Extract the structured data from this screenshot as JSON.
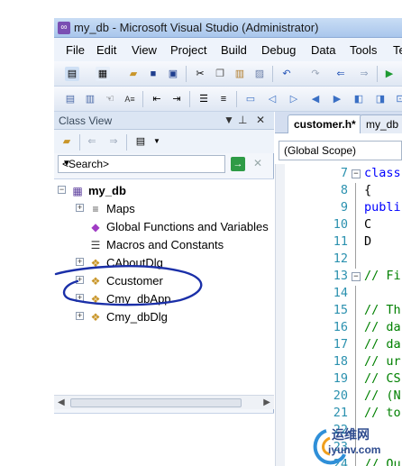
{
  "window": {
    "title": "my_db - Microsoft Visual Studio (Administrator)"
  },
  "menu": [
    "File",
    "Edit",
    "View",
    "Project",
    "Build",
    "Debug",
    "Data",
    "Tools",
    "Te"
  ],
  "class_view": {
    "title": "Class View",
    "search_placeholder": "<Search>",
    "tree": [
      {
        "label": "my_db",
        "level": 0,
        "icon": "project-icon"
      },
      {
        "label": "Maps",
        "level": 1,
        "icon": "maps-icon"
      },
      {
        "label": "Global Functions and Variables",
        "level": 1,
        "icon": "globals-icon"
      },
      {
        "label": "Macros and Constants",
        "level": 1,
        "icon": "macros-icon"
      },
      {
        "label": "CAboutDlg",
        "level": 1,
        "icon": "class-icon"
      },
      {
        "label": "Ccustomer",
        "level": 1,
        "icon": "class-icon"
      },
      {
        "label": "Cmy_dbApp",
        "level": 1,
        "icon": "class-icon"
      },
      {
        "label": "Cmy_dbDlg",
        "level": 1,
        "icon": "class-icon"
      }
    ]
  },
  "editor": {
    "tabs": [
      "customer.h*",
      "my_db"
    ],
    "scope": "(Global Scope)",
    "lines": [
      {
        "n": "7",
        "text": "class",
        "kind": "kw"
      },
      {
        "n": "8",
        "text": "{",
        "kind": "plain"
      },
      {
        "n": "9",
        "text": "publi",
        "kind": "kw"
      },
      {
        "n": "10",
        "text": "C",
        "kind": "plain"
      },
      {
        "n": "11",
        "text": "D",
        "kind": "plain"
      },
      {
        "n": "12",
        "text": "",
        "kind": "plain"
      },
      {
        "n": "13",
        "text": "// Fi",
        "kind": "cm"
      },
      {
        "n": "14",
        "text": "",
        "kind": "plain"
      },
      {
        "n": "15",
        "text": "// Th",
        "kind": "cm"
      },
      {
        "n": "16",
        "text": "// da",
        "kind": "cm"
      },
      {
        "n": "17",
        "text": "// da",
        "kind": "cm"
      },
      {
        "n": "18",
        "text": "// ur",
        "kind": "cm"
      },
      {
        "n": "19",
        "text": "// CS",
        "kind": "cm"
      },
      {
        "n": "20",
        "text": "// (N",
        "kind": "cm"
      },
      {
        "n": "21",
        "text": "// to",
        "kind": "cm"
      },
      {
        "n": "22",
        "text": "",
        "kind": "plain"
      },
      {
        "n": "23",
        "text": "",
        "kind": "plain"
      },
      {
        "n": "24",
        "text": "// Ou",
        "kind": "cm"
      }
    ]
  },
  "watermark": {
    "line1": "运维网",
    "line2": "iyunv.com"
  },
  "colors": {
    "annotation_ink": "#1a2fa8",
    "line_number": "#2b91af",
    "keyword": "#0000ff",
    "comment": "#008000"
  }
}
